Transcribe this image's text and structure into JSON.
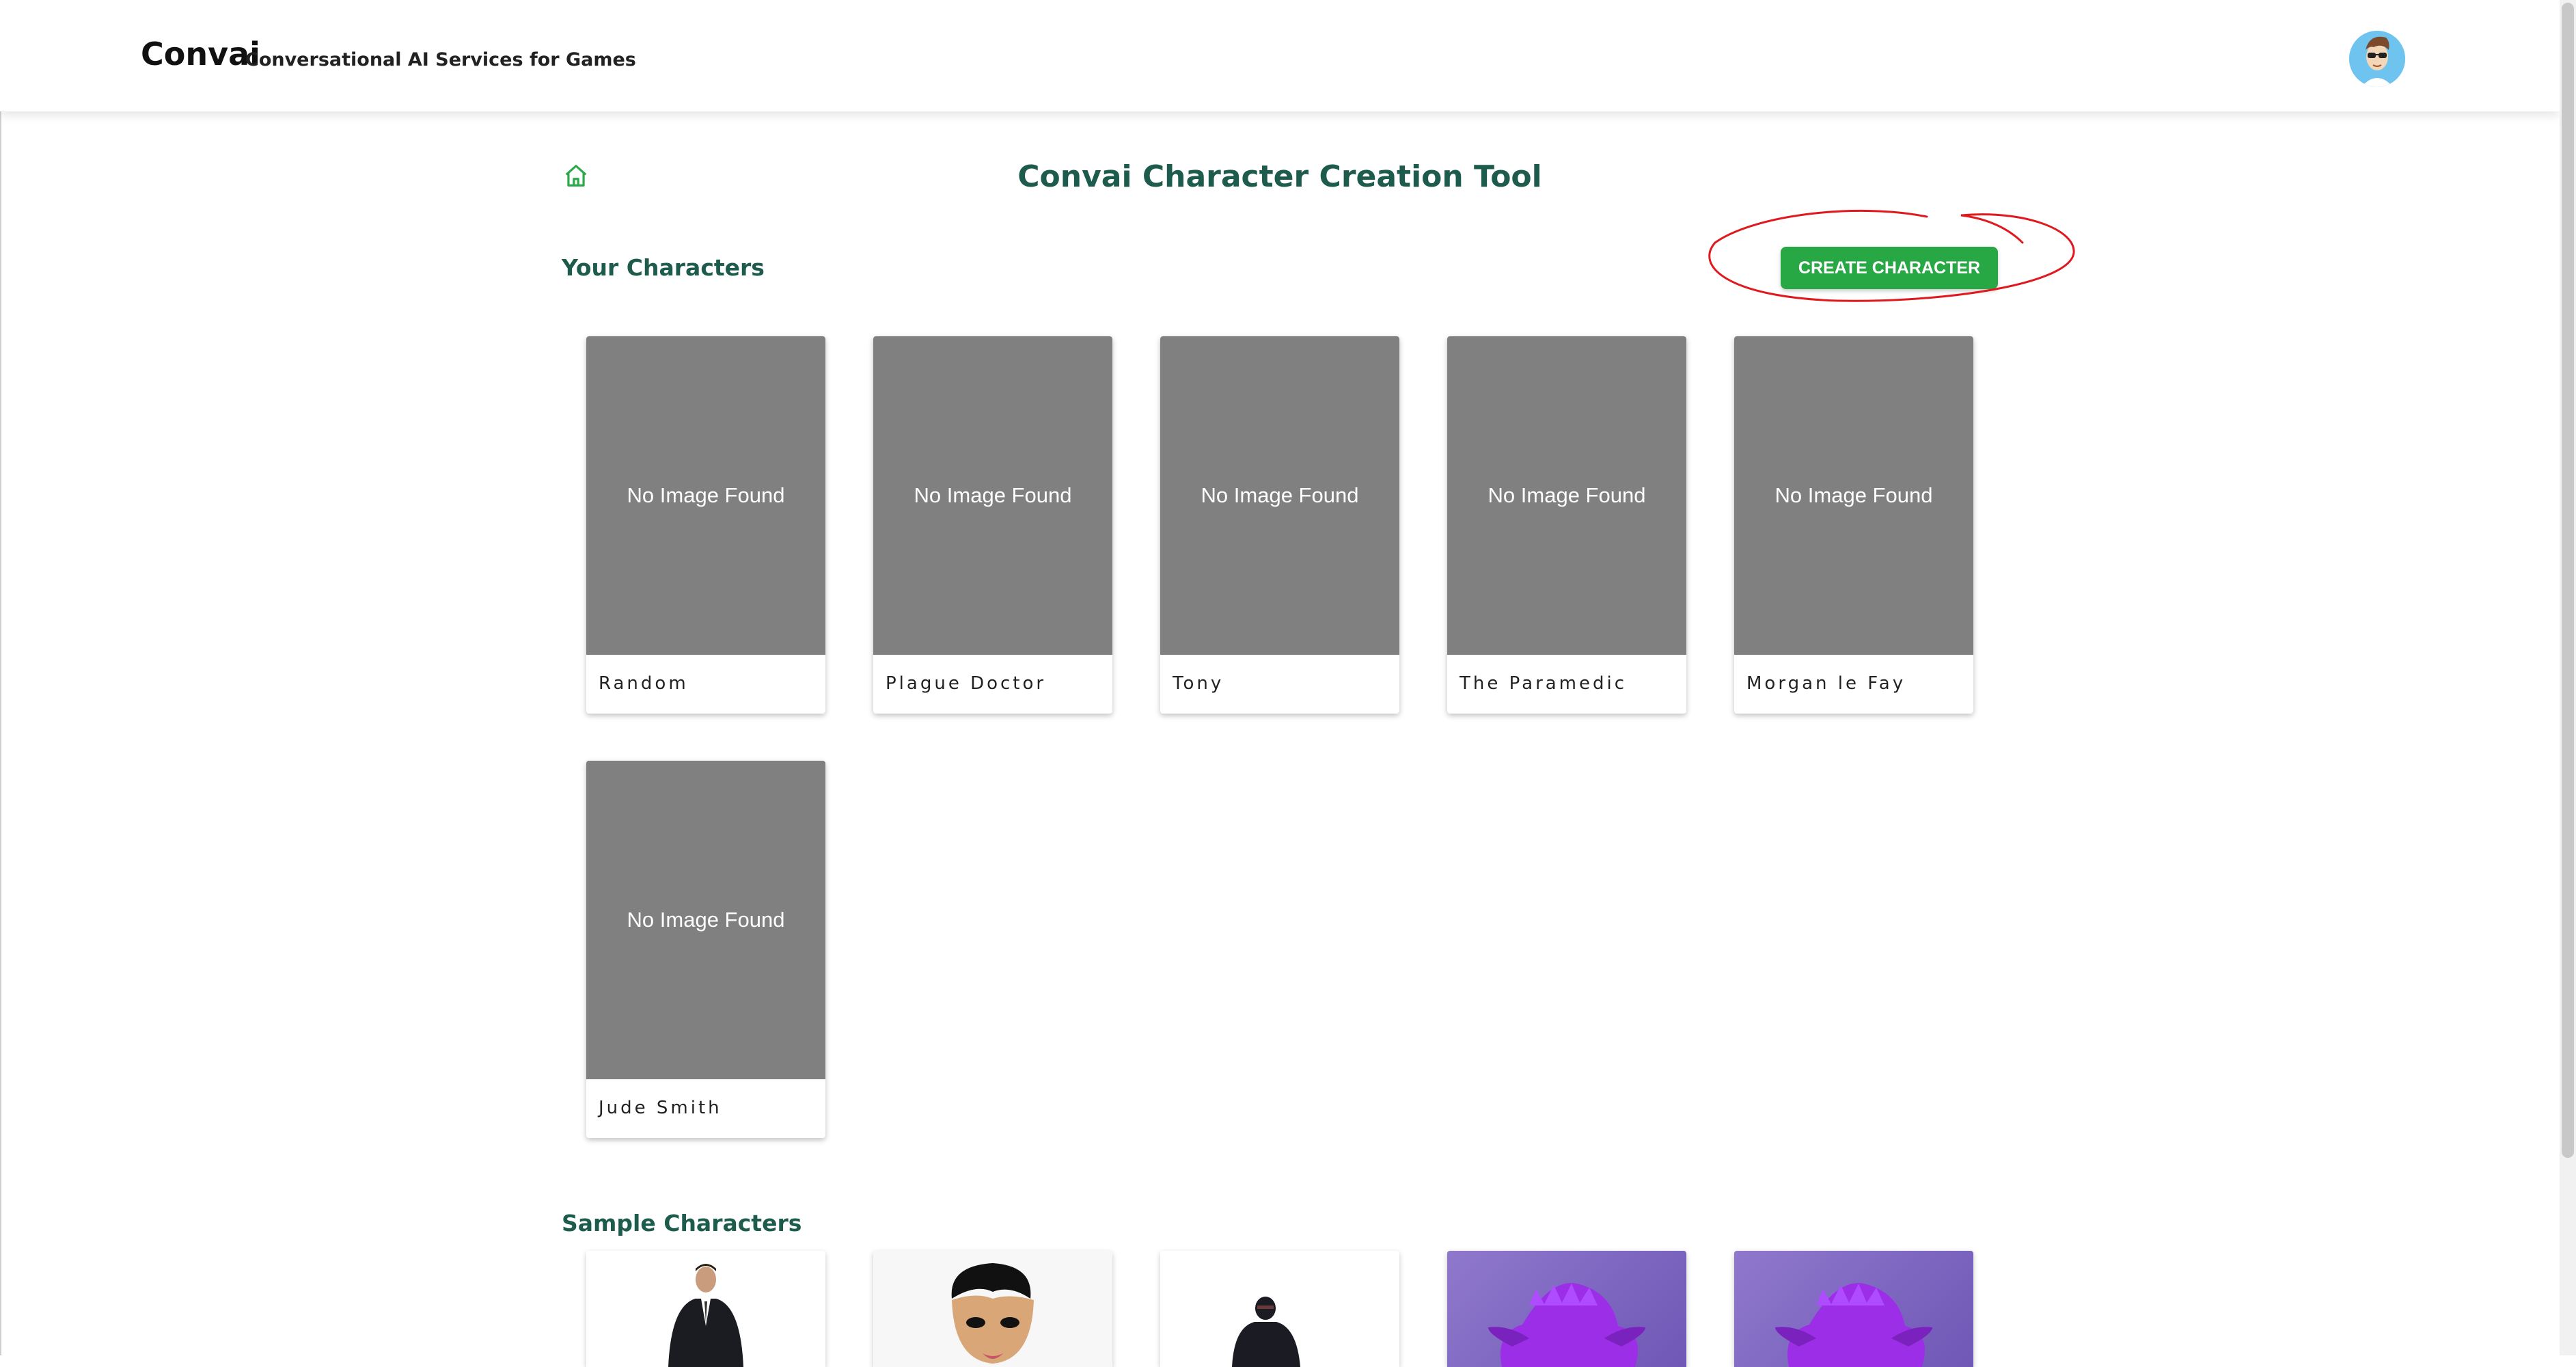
{
  "header": {
    "brand": "Convai",
    "tagline": "Conversational AI Services for Games"
  },
  "page": {
    "title": "Convai Character Creation Tool"
  },
  "your_characters": {
    "heading": "Your Characters",
    "create_label": "CREATE CHARACTER",
    "placeholder_text": "No Image Found",
    "cards": [
      {
        "name": "Random"
      },
      {
        "name": "Plague Doctor"
      },
      {
        "name": "Tony"
      },
      {
        "name": "The Paramedic"
      },
      {
        "name": "Morgan le Fay"
      },
      {
        "name": "Jude Smith"
      }
    ]
  },
  "sample_characters": {
    "heading": "Sample Characters"
  },
  "colors": {
    "accent": "#28a745",
    "heading": "#1d5b4c",
    "placeholder": "#808080",
    "annotation": "#e0191e"
  }
}
